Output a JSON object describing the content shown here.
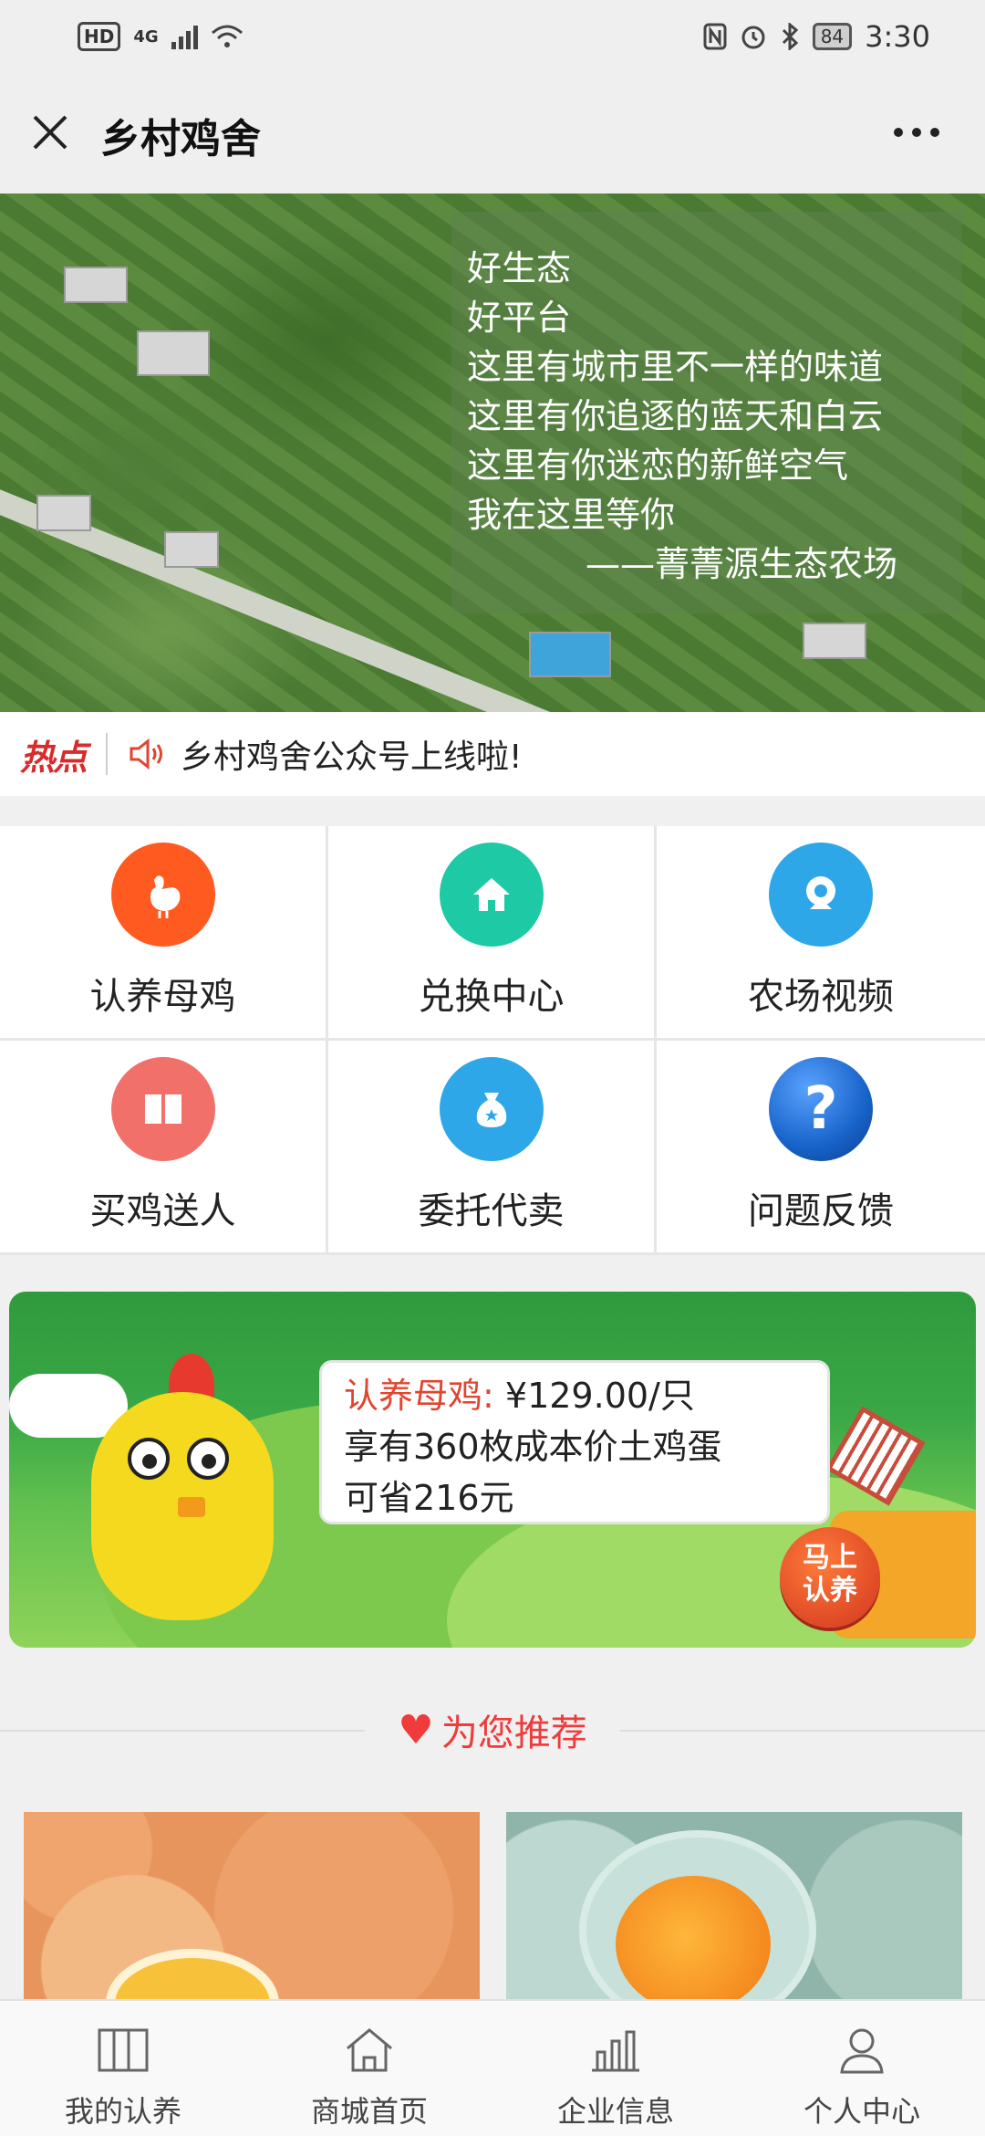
{
  "status_bar": {
    "left_badges": [
      "HD",
      "4G"
    ],
    "battery": "84",
    "time": "3:30"
  },
  "header": {
    "title": "乡村鸡舍"
  },
  "banner": {
    "lines": [
      "好生态",
      "好平台",
      "这里有城市里不一样的味道",
      "这里有你追逐的蓝天和白云",
      "这里有你迷恋的新鲜空气",
      "我在这里等你"
    ],
    "signature": "——菁菁源生态农场",
    "slide_count": 3,
    "active_slide": 3
  },
  "news": {
    "tag": "热点",
    "text": "乡村鸡舍公众号上线啦!"
  },
  "menu": [
    {
      "label": "认养母鸡",
      "icon": "chicken-icon",
      "color": "#ff5a1f"
    },
    {
      "label": "兑换中心",
      "icon": "home-icon",
      "color": "#1ec9a6"
    },
    {
      "label": "农场视频",
      "icon": "camera-icon",
      "color": "#2ea7e8"
    },
    {
      "label": "买鸡送人",
      "icon": "book-icon",
      "color": "#f2706a"
    },
    {
      "label": "委托代卖",
      "icon": "money-bag-icon",
      "color": "#2ea7e8"
    },
    {
      "label": "问题反馈",
      "icon": "question-icon",
      "color": "#1763c9"
    }
  ],
  "promo": {
    "title": "认养母鸡:",
    "price": "¥129.00/只",
    "line2": "享有360枚成本价土鸡蛋",
    "line3": "可省216元",
    "button_line1": "马上",
    "button_line2": "认养"
  },
  "recommend": {
    "title": "为您推荐"
  },
  "tabbar": [
    {
      "label": "我的认养",
      "icon": "columns-icon"
    },
    {
      "label": "商城首页",
      "icon": "home-outline-icon"
    },
    {
      "label": "企业信息",
      "icon": "bar-chart-icon"
    },
    {
      "label": "个人中心",
      "icon": "person-icon"
    }
  ],
  "colors": {
    "accent_red": "#ef3b3b",
    "hot_red": "#d82b2b",
    "promo_green": "#3aa846"
  }
}
